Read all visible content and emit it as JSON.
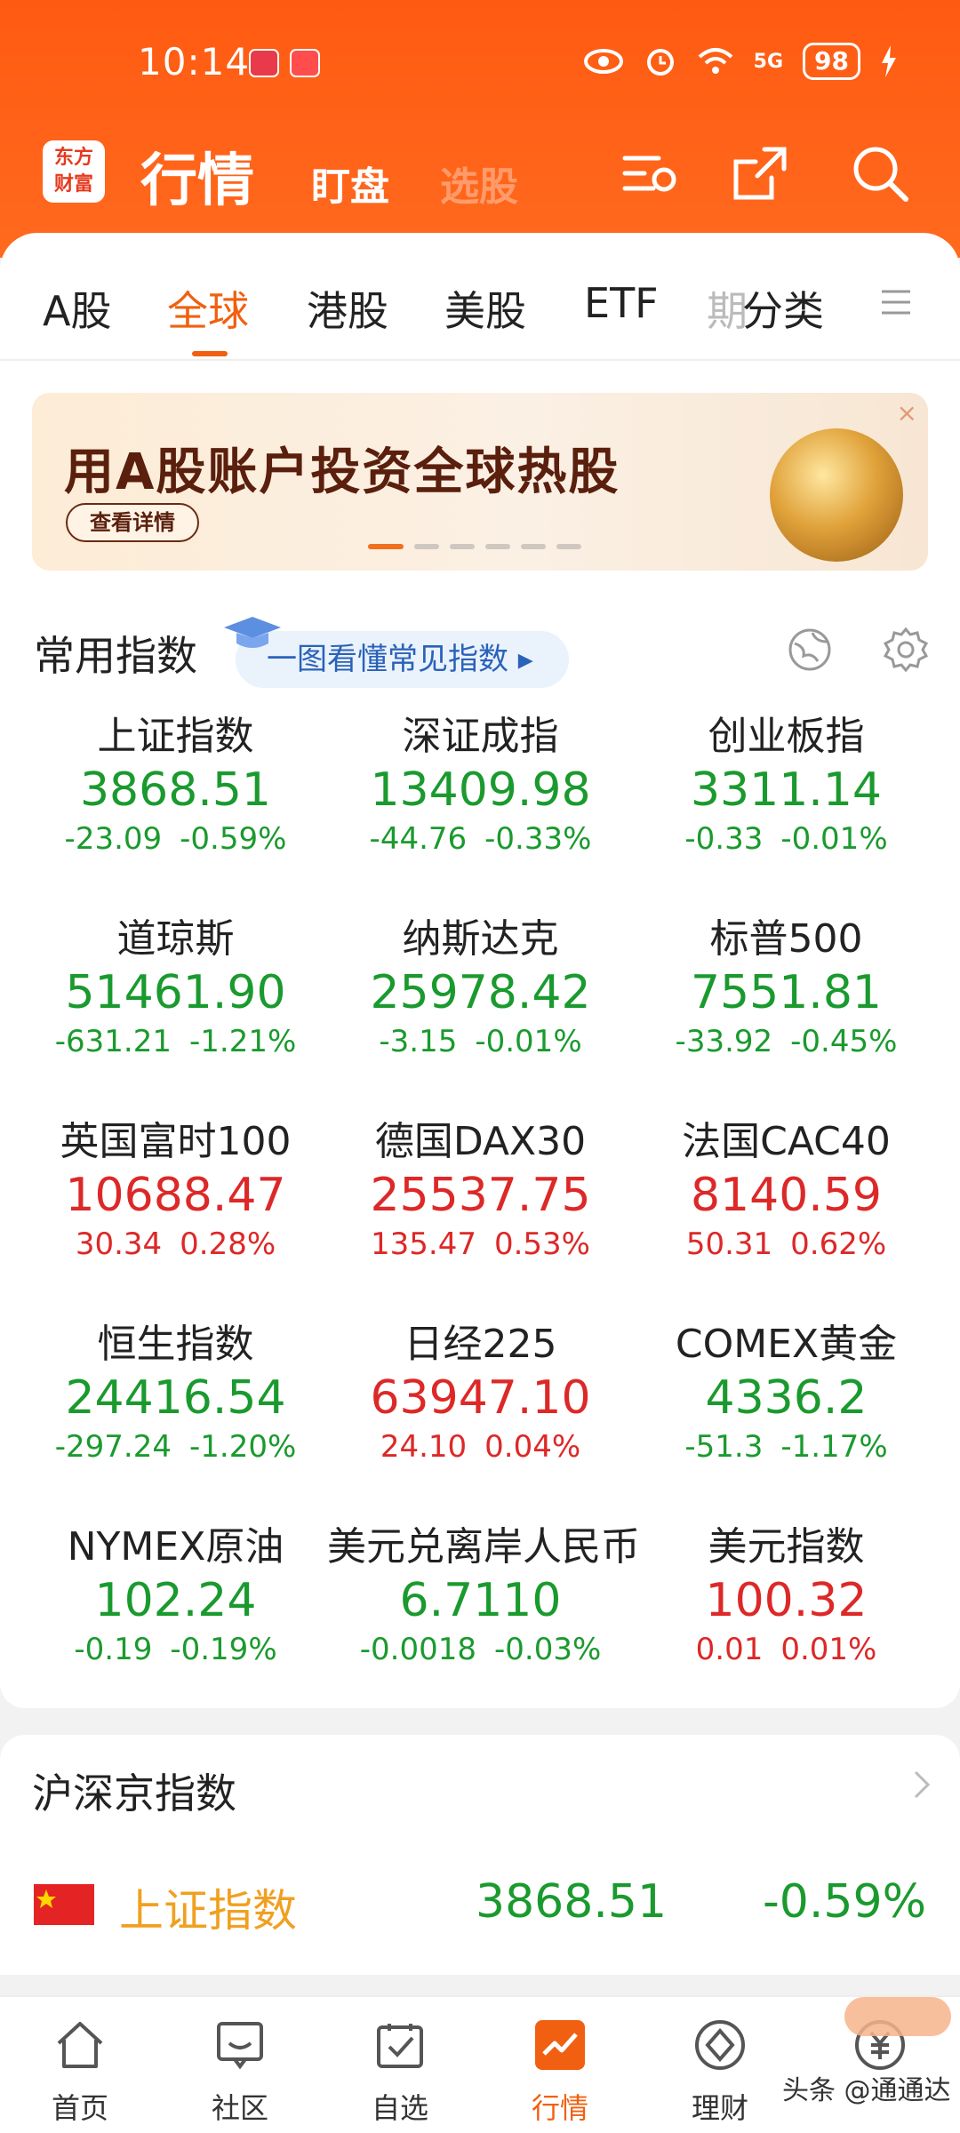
{
  "status_bar": {
    "time": "10:14",
    "battery": "98",
    "network": "5G"
  },
  "header": {
    "title": "行情",
    "tab_watch": "盯盘",
    "tab_faded": "选股",
    "logo_line1": "东方",
    "logo_line2": "财富"
  },
  "tabs": [
    {
      "label": "A股"
    },
    {
      "label": "全球"
    },
    {
      "label": "港股"
    },
    {
      "label": "美股"
    },
    {
      "label": "ETF"
    },
    {
      "label": "期"
    },
    {
      "label": "分类"
    }
  ],
  "active_tab": "全球",
  "banner": {
    "title": "用A股账户投资全球热股",
    "button": "查看详情",
    "close": "×",
    "slide_count": 6,
    "active_slide": 1
  },
  "common_index": {
    "title": "常用指数",
    "promo": "一图看懂常见指数 ▸"
  },
  "indices": [
    {
      "name": "上证指数",
      "price": "3868.51",
      "change": "-23.09",
      "pct": "-0.59%",
      "trend": "down"
    },
    {
      "name": "深证成指",
      "price": "13409.98",
      "change": "-44.76",
      "pct": "-0.33%",
      "trend": "down"
    },
    {
      "name": "创业板指",
      "price": "3311.14",
      "change": "-0.33",
      "pct": "-0.01%",
      "trend": "down"
    },
    {
      "name": "道琼斯",
      "price": "51461.90",
      "change": "-631.21",
      "pct": "-1.21%",
      "trend": "down"
    },
    {
      "name": "纳斯达克",
      "price": "25978.42",
      "change": "-3.15",
      "pct": "-0.01%",
      "trend": "down"
    },
    {
      "name": "标普500",
      "price": "7551.81",
      "change": "-33.92",
      "pct": "-0.45%",
      "trend": "down"
    },
    {
      "name": "英国富时100",
      "price": "10688.47",
      "change": "30.34",
      "pct": "0.28%",
      "trend": "up"
    },
    {
      "name": "德国DAX30",
      "price": "25537.75",
      "change": "135.47",
      "pct": "0.53%",
      "trend": "up"
    },
    {
      "name": "法国CAC40",
      "price": "8140.59",
      "change": "50.31",
      "pct": "0.62%",
      "trend": "up"
    },
    {
      "name": "恒生指数",
      "price": "24416.54",
      "change": "-297.24",
      "pct": "-1.20%",
      "trend": "down"
    },
    {
      "name": "日经225",
      "price": "63947.10",
      "change": "24.10",
      "pct": "0.04%",
      "trend": "up"
    },
    {
      "name": "COMEX黄金",
      "price": "4336.2",
      "change": "-51.3",
      "pct": "-1.17%",
      "trend": "down"
    },
    {
      "name": "NYMEX原油",
      "price": "102.24",
      "change": "-0.19",
      "pct": "-0.19%",
      "trend": "down"
    },
    {
      "name": "美元兑离岸人民币",
      "price": "6.7110",
      "change": "-0.0018",
      "pct": "-0.03%",
      "trend": "down"
    },
    {
      "name": "美元指数",
      "price": "100.32",
      "change": "0.01",
      "pct": "0.01%",
      "trend": "up"
    }
  ],
  "market_list": {
    "title": "沪深京指数",
    "rows": [
      {
        "name": "上证指数",
        "price": "3868.51",
        "pct": "-0.59%"
      }
    ]
  },
  "bottom_nav": [
    {
      "label": "首页"
    },
    {
      "label": "社区"
    },
    {
      "label": "自选"
    },
    {
      "label": "行情"
    },
    {
      "label": "理财"
    }
  ],
  "active_nav": "行情",
  "watermark": "头条 @通通达",
  "colors": {
    "brand": "#ff5a12",
    "up": "#dd2828",
    "down": "#1a9a2e",
    "active": "#f06010"
  }
}
